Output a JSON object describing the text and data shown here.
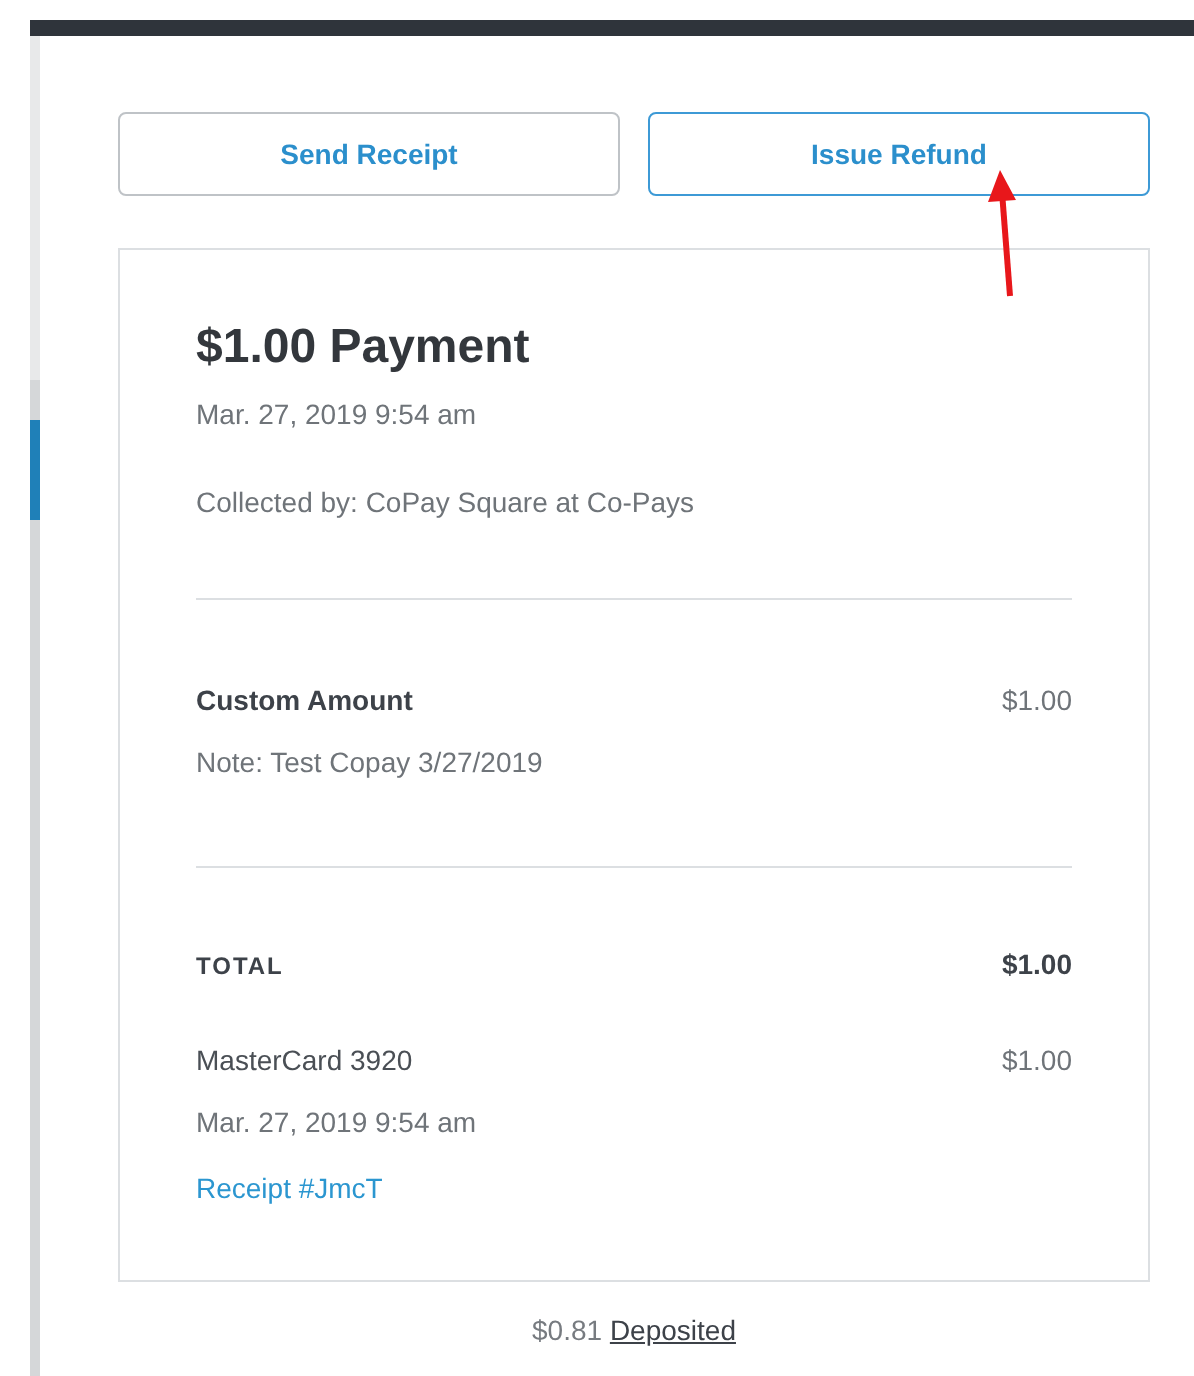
{
  "buttons": [
    {
      "label": "Send Receipt",
      "focused": false
    },
    {
      "label": "Issue Refund",
      "focused": true
    }
  ],
  "payment": {
    "title": "$1.00 Payment",
    "date": "Mar. 27, 2019 9:54 am",
    "collected_by": "Collected by: CoPay Square at Co-Pays"
  },
  "items": [
    {
      "name": "Custom Amount",
      "note": "Note: Test Copay 3/27/2019",
      "amount": "$1.00"
    }
  ],
  "total": {
    "label": "TOTAL",
    "amount": "$1.00"
  },
  "tender": {
    "method": "MasterCard 3920",
    "amount": "$1.00",
    "date": "Mar. 27, 2019 9:54 am",
    "receipt_link": "Receipt #JmcT"
  },
  "footer": {
    "amount": "$0.81",
    "link": "Deposited"
  }
}
